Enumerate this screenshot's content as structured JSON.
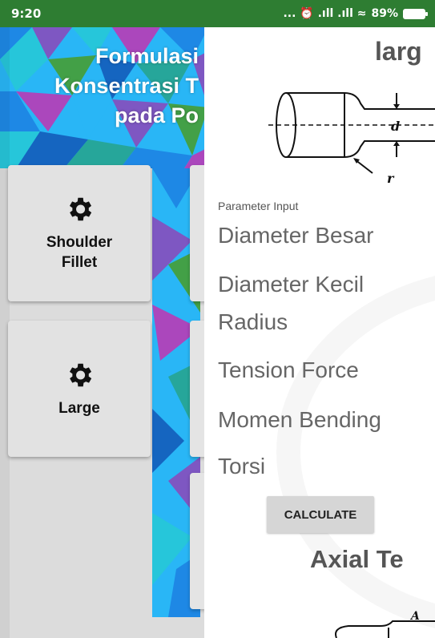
{
  "status_bar": {
    "time": "9:20",
    "indicators": "... ⏰ .ıll .ıll ≈",
    "battery": "89%"
  },
  "background_app": {
    "banner_title_lines": [
      "Formulasi",
      "Konsentrasi T",
      "pada Po"
    ],
    "cards": [
      {
        "label_line1": "Shoulder",
        "label_line2": "Fillet",
        "icon": "gear-icon"
      },
      {
        "label_line1": "Large",
        "label_line2": "",
        "icon": "gear-icon"
      }
    ]
  },
  "panel": {
    "heading": "larg",
    "diagram_labels": {
      "d": "d",
      "r": "r"
    },
    "parameter_caption": "Parameter Input",
    "fields": [
      {
        "placeholder": "Diameter Besar"
      },
      {
        "placeholder": "Diameter Kecil"
      },
      {
        "placeholder": "Radius"
      },
      {
        "placeholder": "Tension Force"
      },
      {
        "placeholder": "Momen Bending"
      },
      {
        "placeholder": "Torsi"
      }
    ],
    "calculate_label": "CALCULATE",
    "section_heading": "Axial Te",
    "diagram2_label": "A"
  },
  "colors": {
    "status_bar": "#2e7d32",
    "accent_mosaic": [
      "#1e88e5",
      "#26c6da",
      "#7e57c2",
      "#43a047",
      "#ab47bc",
      "#29b6f6"
    ]
  }
}
